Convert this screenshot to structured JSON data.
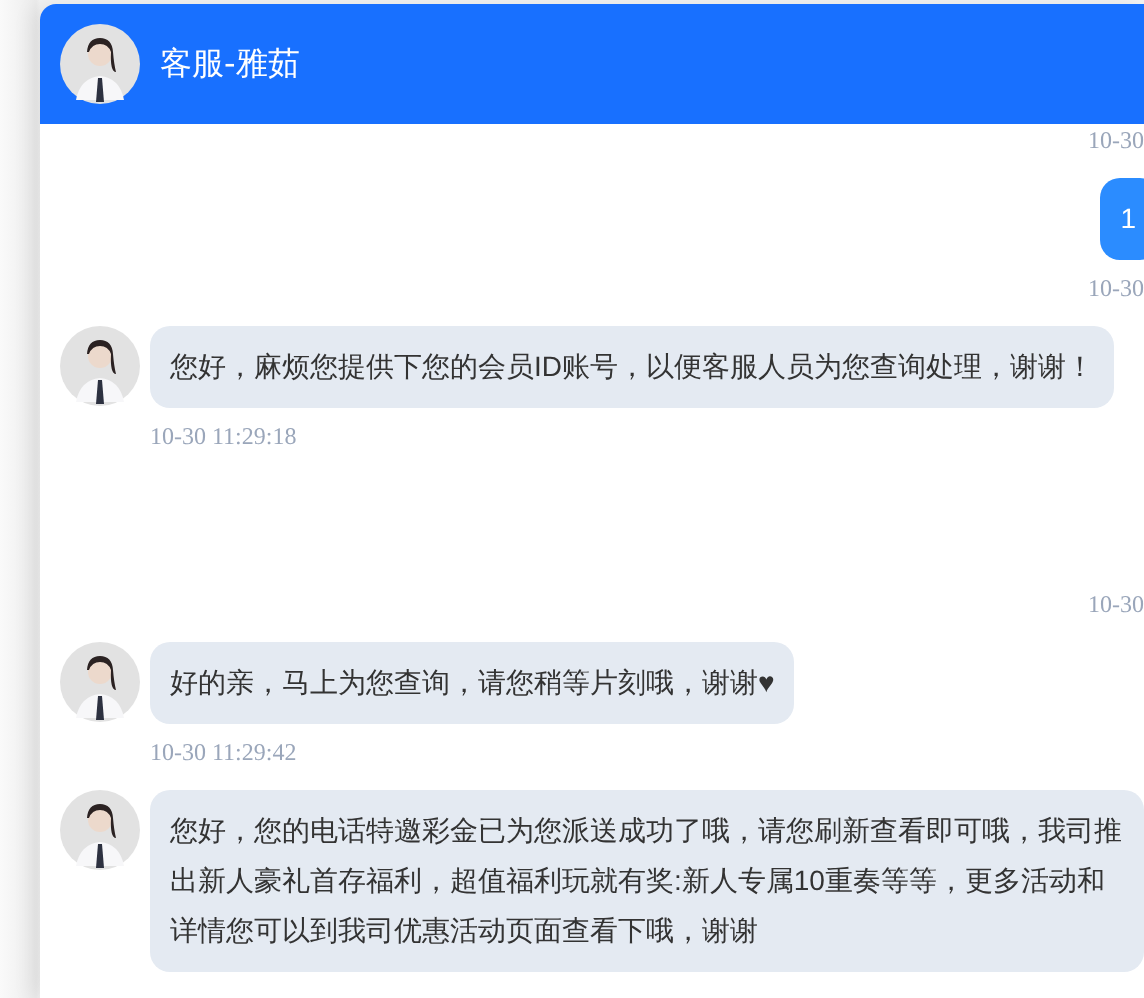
{
  "header": {
    "title": "客服-雅茹"
  },
  "messages": [
    {
      "kind": "time",
      "outgoing": true,
      "text": "10-30"
    },
    {
      "kind": "bubble",
      "outgoing": true,
      "text": "1"
    },
    {
      "kind": "time",
      "outgoing": true,
      "text": "10-30"
    },
    {
      "kind": "bubble",
      "outgoing": false,
      "text": "您好，麻烦您提供下您的会员ID账号，以便客服人员为您查询处理，谢谢！"
    },
    {
      "kind": "time",
      "outgoing": false,
      "text": "10-30 11:29:18"
    },
    {
      "kind": "time",
      "outgoing": true,
      "text": "10-30"
    },
    {
      "kind": "bubble",
      "outgoing": false,
      "text": "好的亲，马上为您查询，请您稍等片刻哦，谢谢♥"
    },
    {
      "kind": "time",
      "outgoing": false,
      "text": "10-30 11:29:42"
    },
    {
      "kind": "bubble",
      "outgoing": false,
      "text": "您好，您的电话特邀彩金已为您派送成功了哦，请您刷新查看即可哦，我司推出新人豪礼首存福利，超值福利玩就有奖:新人专属10重奏等等，更多活动和详情您可以到我司优惠活动页面查看下哦，谢谢"
    }
  ]
}
